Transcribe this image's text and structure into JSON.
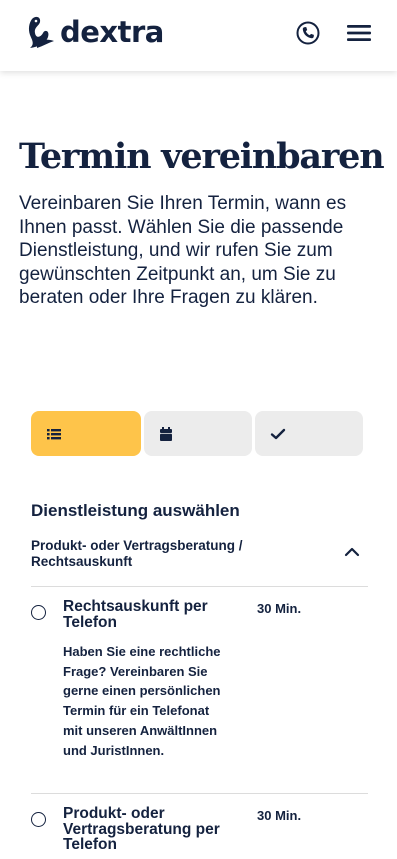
{
  "header": {
    "brand": "dextra",
    "phone_icon": "phone-icon",
    "menu_icon": "hamburger-menu-icon"
  },
  "page": {
    "title": "Termin vereinbaren",
    "intro": "Vereinbaren Sie Ihren Termin, wann es Ihnen passt. Wählen Sie die passende Dienstleistung, und wir rufen Sie zum gewünschten Zeitpunkt an, um Sie zu beraten oder Ihre Fragen zu klären."
  },
  "steps": [
    {
      "icon": "list-icon",
      "active": true
    },
    {
      "icon": "calendar-icon",
      "active": false
    },
    {
      "icon": "checkmark-icon",
      "active": false
    }
  ],
  "colors": {
    "brand_navy": "#14223f",
    "accent_yellow": "#fec44a",
    "inactive_step": "#ececec"
  },
  "services_section": {
    "title": "Dienstleistung auswählen",
    "category": "Produkt- oder Vertragsberatung / Rechtsauskunft",
    "category_expanded": true,
    "items": [
      {
        "name": "Rechtsauskunft per Telefon",
        "duration": "30 Min.",
        "description": "Haben Sie eine rechtliche Frage? Vereinbaren Sie gerne einen persönlichen Termin für ein Telefonat mit unseren AnwältInnen und JuristInnen.",
        "selected": false
      },
      {
        "name": "Produkt- oder Vertragsberatung per Telefon",
        "duration": "30 Min.",
        "selected": false
      }
    ]
  }
}
